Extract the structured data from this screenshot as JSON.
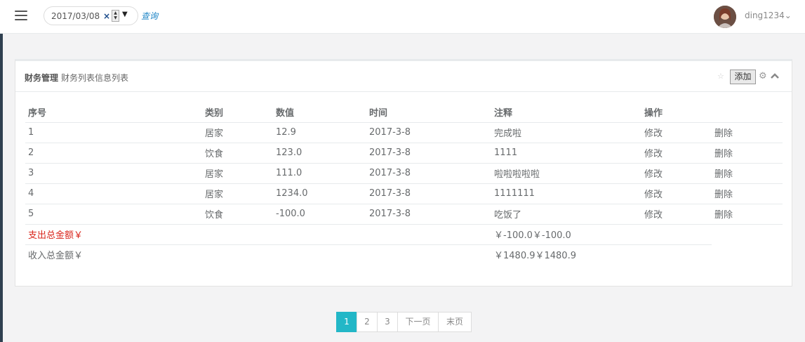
{
  "topbar": {
    "date_value": "2017/03/08",
    "date_clear": "×",
    "date_dropdown": "▼",
    "query_label": "查询",
    "username": "ding1234",
    "username_caret": "⌄"
  },
  "panel": {
    "title_main": "财务管理",
    "title_sub": "财务列表信息列表",
    "add_label": "添加"
  },
  "table": {
    "headers": [
      "序号",
      "类别",
      "数值",
      "时间",
      "注释",
      "操作"
    ],
    "rows": [
      {
        "id": "1",
        "category": "居家",
        "value": "12.9",
        "time": "2017-3-8",
        "note": "完成啦",
        "edit": "修改",
        "delete": "删除"
      },
      {
        "id": "2",
        "category": "饮食",
        "value": "123.0",
        "time": "2017-3-8",
        "note": "1111",
        "edit": "修改",
        "delete": "删除"
      },
      {
        "id": "3",
        "category": "居家",
        "value": "111.0",
        "time": "2017-3-8",
        "note": "啦啦啦啦啦",
        "edit": "修改",
        "delete": "删除"
      },
      {
        "id": "4",
        "category": "居家",
        "value": "1234.0",
        "time": "2017-3-8",
        "note": "1111111",
        "edit": "修改",
        "delete": "删除"
      },
      {
        "id": "5",
        "category": "饮食",
        "value": "-100.0",
        "time": "2017-3-8",
        "note": "吃饭了",
        "edit": "修改",
        "delete": "删除"
      }
    ],
    "expense_label": "支出总金额￥",
    "expense_value": "￥-100.0￥-100.0",
    "income_label": "收入总金额￥",
    "income_value": "￥1480.9￥1480.9"
  },
  "pagination": {
    "pages": [
      "1",
      "2",
      "3"
    ],
    "next": "下一页",
    "last": "末页"
  },
  "colors": {
    "accent": "#23b7c7",
    "expense": "#d9261c",
    "sidebar": "#2f4050"
  }
}
